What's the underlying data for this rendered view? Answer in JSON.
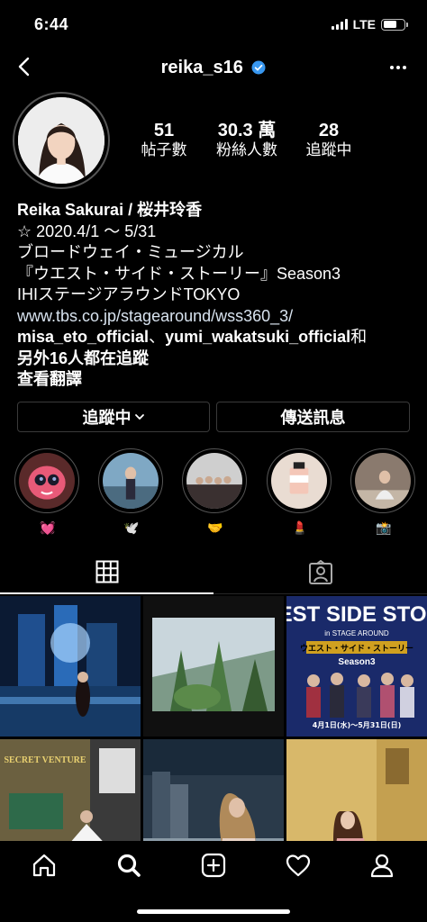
{
  "status": {
    "time": "6:44",
    "network": "LTE",
    "battery_level": 0.65
  },
  "header": {
    "username": "reika_s16"
  },
  "stats": [
    {
      "value": "51",
      "label": "帖子數"
    },
    {
      "value": "30.3 萬",
      "label": "粉絲人數"
    },
    {
      "value": "28",
      "label": "追蹤中"
    }
  ],
  "bio": {
    "name": "Reika Sakurai / 桜井玲香",
    "line1": "☆ 2020.4/1 ～ 5/31",
    "line2": "ブロードウェイ・ミュージカル",
    "line3": "『ウエスト・サイド・ストーリー』Season3",
    "line4": "IHIステージアラウンドTOKYO",
    "link": "www.tbs.co.jp/stagearound/wss360_3/",
    "followed_a": "misa_eto_official",
    "followed_sep": "、",
    "followed_b": "yumi_wakatsuki_official",
    "followed_c": "和",
    "followed_more": "另外16人都在追蹤",
    "translate": "查看翻譯"
  },
  "buttons": {
    "following": "追蹤中",
    "message": "傳送訊息"
  },
  "highlights": [
    {
      "caption": "💓"
    },
    {
      "caption": "🕊️"
    },
    {
      "caption": "🤝"
    },
    {
      "caption": "💄"
    },
    {
      "caption": "📸"
    }
  ],
  "posts": {
    "poster_title": "WEST SIDE STORY",
    "poster_sub": "in STAGE AROUND",
    "poster_jp": "ウエスト・サイド・ストーリー",
    "poster_season": "Season3",
    "poster_dates": "4月1日(水)～5月31日(日)",
    "secret_sign": "SECRET VENTURE"
  }
}
